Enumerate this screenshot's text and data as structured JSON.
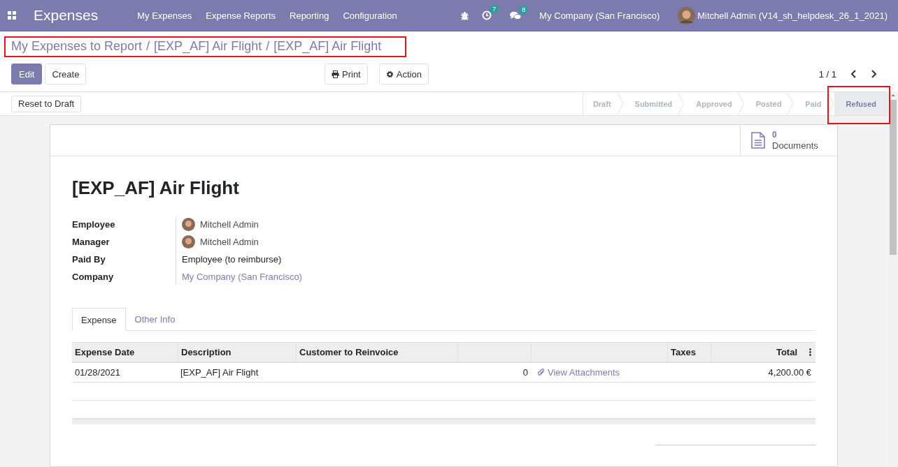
{
  "navbar": {
    "app_name": "Expenses",
    "menu": [
      "My Expenses",
      "Expense Reports",
      "Reporting",
      "Configuration"
    ],
    "activity_count": "7",
    "message_count": "8",
    "company": "My Company (San Francisco)",
    "user": "Mitchell Admin (V14_sh_helpdesk_26_1_2021)"
  },
  "breadcrumb": {
    "highlighted": true,
    "items": [
      {
        "label": "My Expenses to Report"
      },
      {
        "label": "/"
      },
      {
        "label": "[EXP_AF] Air Flight"
      },
      {
        "label": "/"
      },
      {
        "label": "[EXP_AF] Air Flight"
      }
    ]
  },
  "buttons": {
    "edit": "Edit",
    "create": "Create",
    "print": "Print",
    "action": "Action"
  },
  "pager": "1 / 1",
  "reset_button": "Reset to Draft",
  "stages": [
    {
      "label": "Draft",
      "selected": false,
      "highlighted": false
    },
    {
      "label": "Submitted",
      "selected": false,
      "highlighted": false
    },
    {
      "label": "Approved",
      "selected": false,
      "highlighted": false
    },
    {
      "label": "Posted",
      "selected": false,
      "highlighted": false
    },
    {
      "label": "Paid",
      "selected": false,
      "highlighted": false
    },
    {
      "label": "Refused",
      "selected": true,
      "highlighted": true
    }
  ],
  "smart_button": {
    "count": "0",
    "label": "Documents"
  },
  "title": "[EXP_AF] Air Flight",
  "fields": [
    {
      "label": "Employee",
      "value": "Mitchell Admin",
      "kind": "user"
    },
    {
      "label": "Manager",
      "value": "Mitchell Admin",
      "kind": "user"
    },
    {
      "label": "Paid By",
      "value": "Employee (to reimburse)",
      "kind": "text"
    },
    {
      "label": "Company",
      "value": "My Company (San Francisco)",
      "kind": "link"
    }
  ],
  "tabs": [
    {
      "label": "Expense",
      "selected": true
    },
    {
      "label": "Other Info",
      "selected": false
    }
  ],
  "table": {
    "columns": [
      {
        "label": "Expense Date",
        "kind": "text"
      },
      {
        "label": "Description",
        "kind": "text"
      },
      {
        "label": "Customer to Reinvoice",
        "kind": "text"
      },
      {
        "kind": "blank"
      },
      {
        "kind": "blank"
      },
      {
        "label": "Taxes",
        "kind": "text"
      },
      {
        "label": "Total",
        "kind": "total"
      }
    ],
    "rows": [
      {
        "expense_date": "01/28/2021",
        "description": "[EXP_AF] Air Flight",
        "column_4": "0",
        "column_5": "View Attachments",
        "total": "4,200.00 €"
      }
    ]
  }
}
